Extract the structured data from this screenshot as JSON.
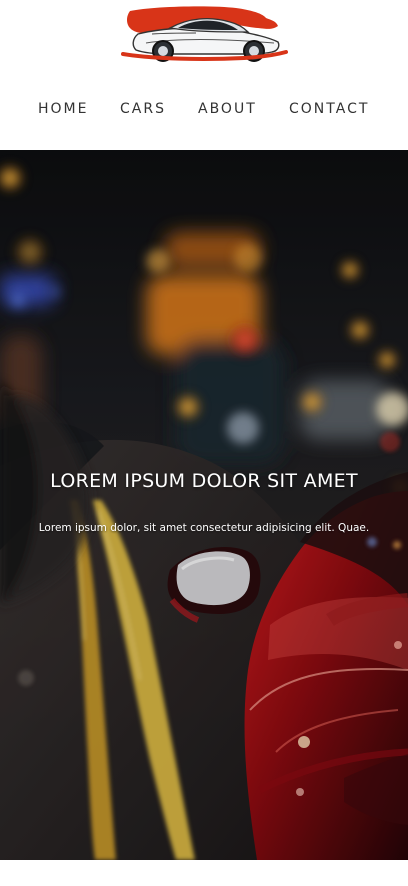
{
  "brand": {
    "logo_icon": "sports-car-icon",
    "accent": "#d83418"
  },
  "nav": {
    "items": [
      {
        "label": "HOME"
      },
      {
        "label": "CARS"
      },
      {
        "label": "ABOUT"
      },
      {
        "label": "CONTACT"
      }
    ]
  },
  "hero": {
    "title": "LOREM IPSUM DOLOR SIT AMET",
    "text": "Lorem ipsum dolor, sit amet consectetur adipisicing elit. Quae."
  }
}
